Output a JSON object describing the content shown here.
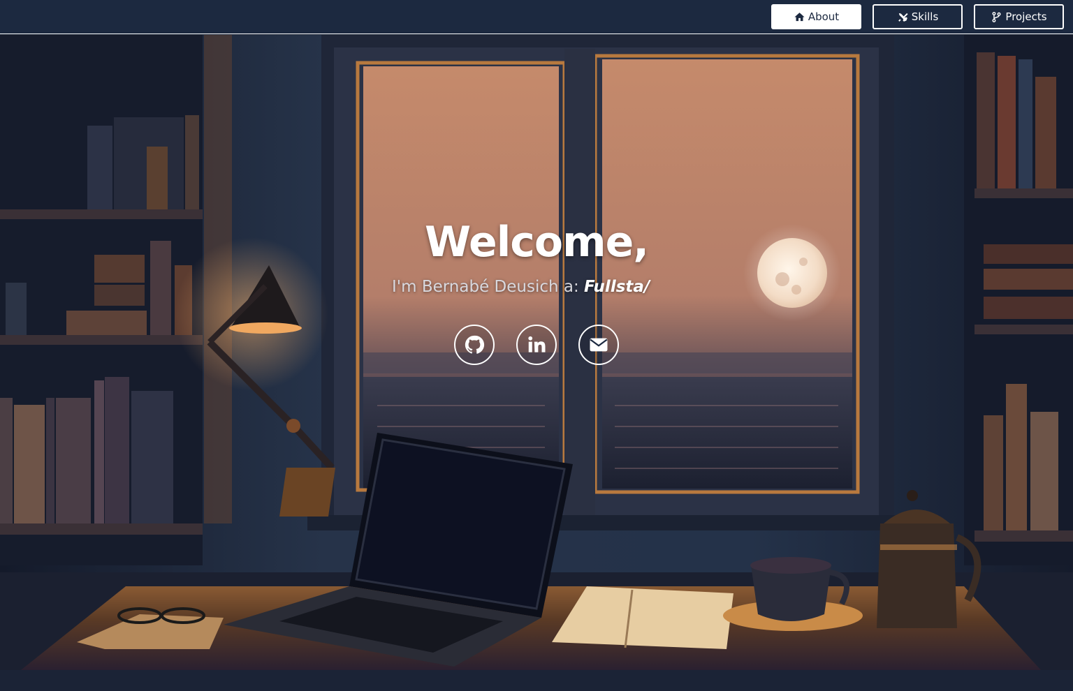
{
  "nav": {
    "about_label": "About",
    "skills_label": "Skills",
    "projects_label": "Projects",
    "active": "About"
  },
  "hero": {
    "title": "Welcome,",
    "subtitle_prefix": "I'm Bernabé Deusich a: ",
    "typed_text": "Fullsta/"
  },
  "socials": [
    {
      "name": "github",
      "icon": "github-icon"
    },
    {
      "name": "linkedin",
      "icon": "linkedin-icon"
    },
    {
      "name": "email",
      "icon": "envelope-icon"
    }
  ],
  "colors": {
    "navbar_bg": "#1c2940",
    "accent": "#ffffff",
    "sky": "#c0876a",
    "lamp_glow": "#f0a860"
  }
}
